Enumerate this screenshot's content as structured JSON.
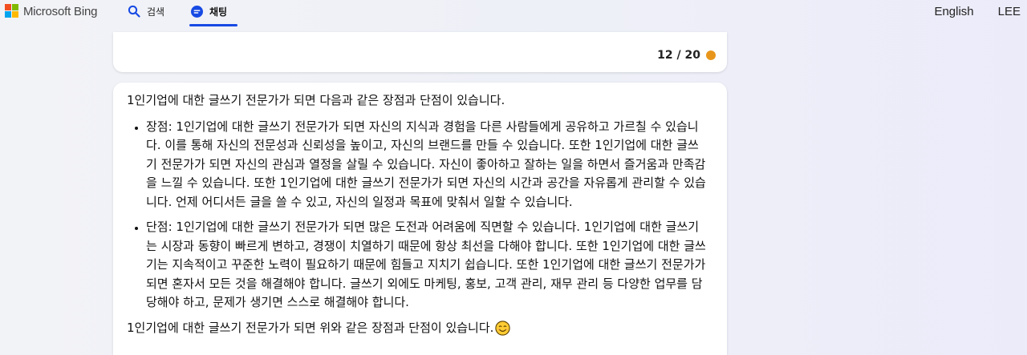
{
  "header": {
    "brand": "Microsoft Bing",
    "tabs": [
      {
        "label": "검색",
        "icon": "search-icon"
      },
      {
        "label": "채팅",
        "icon": "chat-bubble-icon"
      }
    ],
    "language": "English",
    "user": "LEE",
    "colors": {
      "accent": "#174ae4",
      "ms_red": "#f25022",
      "ms_green": "#7fba00",
      "ms_blue": "#00a4ef",
      "ms_yellow": "#ffb900"
    }
  },
  "previous_message": {
    "counter": "12 / 20",
    "status_color": "#e8961b"
  },
  "message": {
    "intro": "1인기업에 대한 글쓰기 전문가가 되면 다음과 같은 장점과 단점이 있습니다.",
    "items": [
      "장점: 1인기업에 대한 글쓰기 전문가가 되면 자신의 지식과 경험을 다른 사람들에게 공유하고 가르칠 수 있습니다. 이를 통해 자신의 전문성과 신뢰성을 높이고, 자신의 브랜드를 만들 수 있습니다. 또한 1인기업에 대한 글쓰기 전문가가 되면 자신의 관심과 열정을 살릴 수 있습니다. 자신이 좋아하고 잘하는 일을 하면서 즐거움과 만족감을 느낄 수 있습니다. 또한 1인기업에 대한 글쓰기 전문가가 되면 자신의 시간과 공간을 자유롭게 관리할 수 있습니다. 언제 어디서든 글을 쓸 수 있고, 자신의 일정과 목표에 맞춰서 일할 수 있습니다.",
      "단점: 1인기업에 대한 글쓰기 전문가가 되면 많은 도전과 어려움에 직면할 수 있습니다. 1인기업에 대한 글쓰기는 시장과 동향이 빠르게 변하고, 경쟁이 치열하기 때문에 항상 최선을 다해야 합니다. 또한 1인기업에 대한 글쓰기는 지속적이고 꾸준한 노력이 필요하기 때문에 힘들고 지치기 쉽습니다. 또한 1인기업에 대한 글쓰기 전문가가 되면 혼자서 모든 것을 해결해야 합니다. 글쓰기 외에도 마케팅, 홍보, 고객 관리, 재무 관리 등 다양한 업무를 담당해야 하고, 문제가 생기면 스스로 해결해야 합니다."
    ],
    "outro": "1인기업에 대한 글쓰기 전문가가 되면 위와 같은 장점과 단점이 있습니다.",
    "outro_emoji": "smiling-face-emoji"
  }
}
